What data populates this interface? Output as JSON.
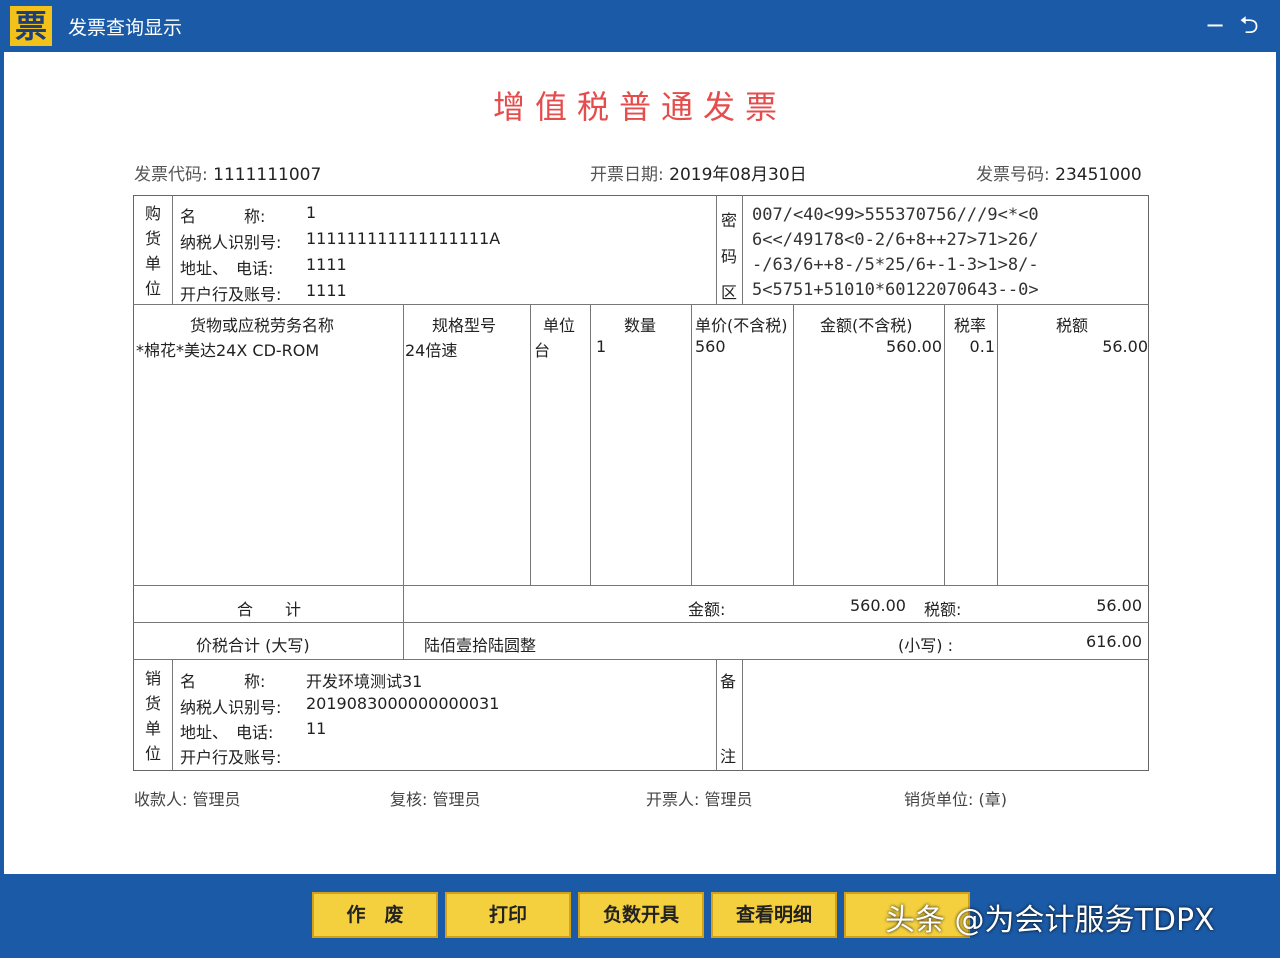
{
  "window": {
    "title": "发票查询显示",
    "icon_char": "票",
    "minimize_glyph": "−",
    "back_glyph": "⮌"
  },
  "invoice": {
    "title": "增值税普通发票",
    "code_label": "发票代码:",
    "code": "1111111007",
    "date_label": "开票日期:",
    "date": "2019年08月30日",
    "number_label": "发票号码:",
    "number": "23451000"
  },
  "buyer": {
    "side_label": [
      "购",
      "货",
      "单",
      "位"
    ],
    "name_label": "名　　　称:",
    "name": "1",
    "tax_label": "纳税人识别号:",
    "tax_id": "111111111111111111A",
    "addr_label": "地址、　电话:",
    "addr": "1111",
    "bank_label": "开户行及账号:",
    "bank": "1111"
  },
  "cipher": {
    "side_label": [
      "密",
      "码",
      "区"
    ],
    "lines": [
      "007/<40<99>555370756///9<*<0",
      "6<</49178<0-2/6+8++27>71>26/",
      "-/63/6++8-/5*25/6+-1-3>1>8/-",
      "5<5751+51010*60122070643--0>"
    ]
  },
  "items_table": {
    "headers": [
      "货物或应税劳务名称",
      "规格型号",
      "单位",
      "数量",
      "单价(不含税)",
      "金额(不含税)",
      "税率",
      "税额"
    ],
    "rows": [
      {
        "name": "*棉花*美达24X CD-ROM",
        "spec": "24倍速",
        "unit": "台",
        "qty": "1",
        "price": "560",
        "amount": "560.00",
        "rate": "0.1",
        "tax": "56.00"
      }
    ]
  },
  "totals": {
    "label": "合　　计",
    "amount_label": "金额:",
    "amount": "560.00",
    "tax_label": "税额:",
    "tax": "56.00",
    "grand_label": "价税合计 (大写)",
    "grand_words": "陆佰壹拾陆圆整",
    "small_label": "(小写) :",
    "grand": "616.00"
  },
  "seller": {
    "side_label": [
      "销",
      "货",
      "单",
      "位"
    ],
    "name_label": "名　　　称:",
    "name": "开发环境测试31",
    "tax_label": "纳税人识别号:",
    "tax_id": "2019083000000000031",
    "addr_label": "地址、　电话:",
    "addr": "11",
    "bank_label": "开户行及账号:",
    "bank": ""
  },
  "remark": {
    "label_top": "备",
    "label_bottom": "注"
  },
  "footer": {
    "payee": "收款人: 管理员",
    "reviewer": "复核: 管理员",
    "issuer": "开票人: 管理员",
    "seller_stamp": "销货单位: (章)"
  },
  "buttons": [
    "作　废",
    "打印",
    "负数开具",
    "查看明细"
  ],
  "watermark": "头条 @为会计服务TDPX"
}
